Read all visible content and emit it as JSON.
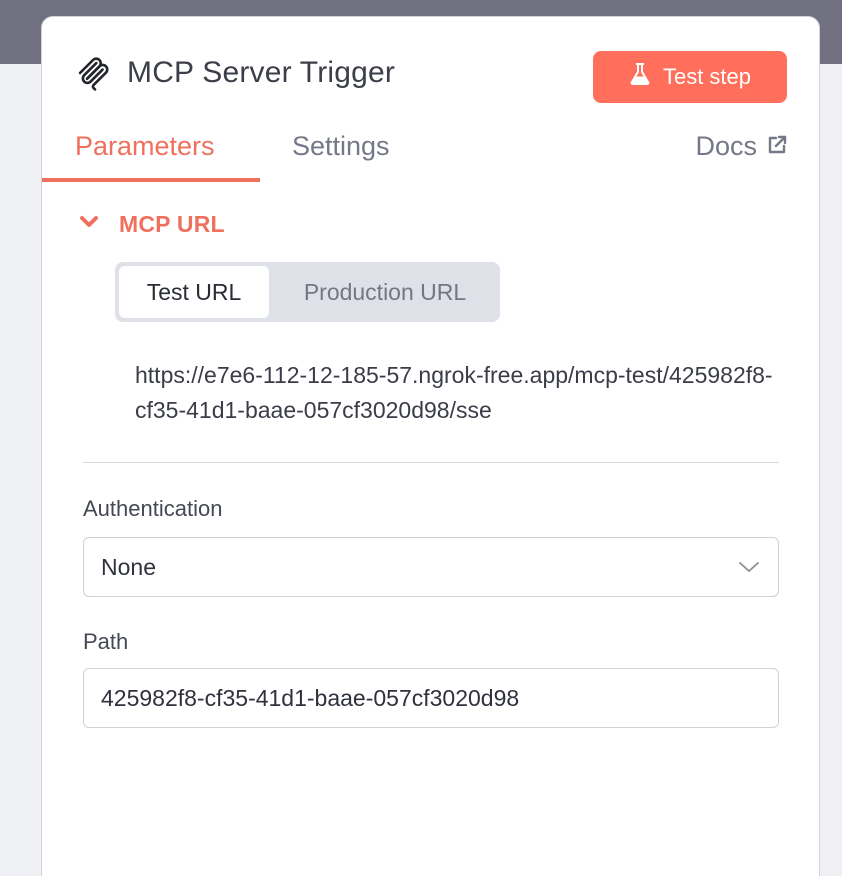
{
  "node": {
    "icon": "mcp-icon",
    "title": "MCP Server Trigger",
    "test_step_label": "Test step",
    "test_step_icon": "flask-icon"
  },
  "tabs": {
    "items": [
      "Parameters",
      "Settings"
    ],
    "active": "Parameters",
    "docs_label": "Docs",
    "docs_icon": "external-link-icon"
  },
  "mcp_url": {
    "section_title": "MCP URL",
    "toggle_icon": "chevron-down-icon",
    "options": [
      "Test URL",
      "Production URL"
    ],
    "selected": "Test URL",
    "url": "https://e7e6-112-12-185-57.ngrok-free.app/mcp-test/425982f8-cf35-41d1-baae-057cf3020d98/sse"
  },
  "authentication": {
    "label": "Authentication",
    "value": "None",
    "icon": "chevron-down-icon"
  },
  "path": {
    "label": "Path",
    "value": "425982f8-cf35-41d1-baae-057cf3020d98"
  },
  "colors": {
    "accent": "#ff6f5c",
    "accent_text": "#f0705e",
    "panel_bg": "#ffffff",
    "page_bg": "#eef0f4"
  }
}
